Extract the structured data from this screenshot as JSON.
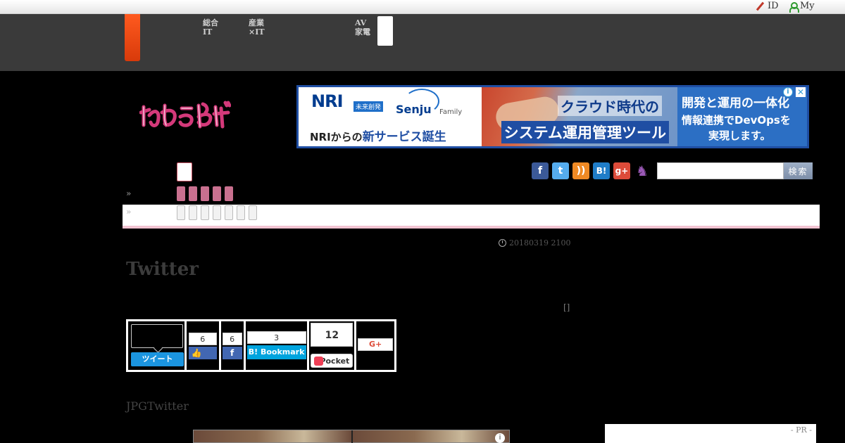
{
  "topbar": {
    "id_label": "ID",
    "my_label": "My"
  },
  "gnav": {
    "items": [
      {
        "label": "総合\nIT"
      },
      {
        "label": "産業×IT"
      },
      {
        "label": "AV\n家電"
      }
    ]
  },
  "ad": {
    "brand": "NRI",
    "brand_sub": "未来創発",
    "product": "Senju",
    "product_family": "Family",
    "tagline_prefix": "NRIからの",
    "tagline_highlight": "新サービス誕生",
    "headline_1": "クラウド時代の",
    "headline_2": "システム運用管理ツール",
    "right_1": "開発と運用の一体化",
    "right_2": "情報連携でDevOpsを",
    "right_3": "実現します。",
    "info_glyph": "i",
    "close_glyph": "✕"
  },
  "social": {
    "facebook_glyph": "f",
    "twitter_glyph": "t",
    "rss_glyph": "))",
    "hatena_glyph": "B!",
    "gplus_glyph": "g+",
    "cat_glyph": "♞"
  },
  "search": {
    "button_label": "検索",
    "placeholder": ""
  },
  "breadcrumb": {
    "mark_1": "»",
    "mark_2": "»"
  },
  "article": {
    "date": "20180319 2100",
    "title": "Twitter",
    "bracket": "[]",
    "lead": "JPGTwitter"
  },
  "share": {
    "tweet_label": "ツイート",
    "fb_like_count": "6",
    "fb_share_count": "6",
    "hatena_count": "3",
    "hatena_label": "B! Bookmark",
    "pocket_count": "12",
    "pocket_label": "Pocket",
    "gplus_label": "G+"
  },
  "sidebar": {
    "pr_label": "- PR -"
  },
  "colors": {
    "nav_bg": "#3a3a3a",
    "brand_tab": "#ff5a1f",
    "pink_accent": "#c9708f",
    "tweet_blue": "#1b95e0",
    "fb_blue": "#4267b2",
    "hatena_blue": "#00a4de"
  }
}
